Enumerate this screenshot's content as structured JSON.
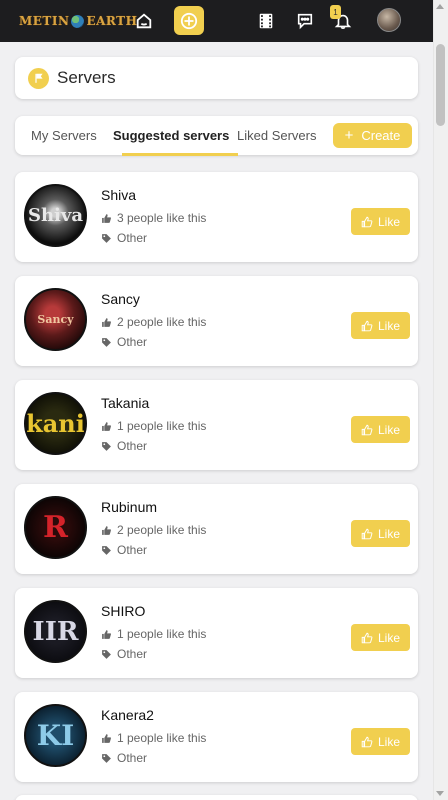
{
  "app": {
    "logo_left": "METIN",
    "logo_right": "EARTH",
    "notification_count": "1"
  },
  "header": {
    "title": "Servers"
  },
  "tabs": [
    {
      "label": "My Servers"
    },
    {
      "label": "Suggested servers",
      "active": true
    },
    {
      "label": "Liked Servers"
    }
  ],
  "create_button": {
    "plus": "+",
    "label": "Create"
  },
  "servers": [
    {
      "name": "Shiva",
      "likes": "3 people like this",
      "category": "Other",
      "like_label": "Like",
      "avatar_text": "Shiva"
    },
    {
      "name": "Sancy",
      "likes": "2 people like this",
      "category": "Other",
      "like_label": "Like",
      "avatar_text": "Sancy"
    },
    {
      "name": "Takania",
      "likes": "1 people like this",
      "category": "Other",
      "like_label": "Like",
      "avatar_text": "kani"
    },
    {
      "name": "Rubinum",
      "likes": "2 people like this",
      "category": "Other",
      "like_label": "Like",
      "avatar_text": "R"
    },
    {
      "name": "SHIRO",
      "likes": "1 people like this",
      "category": "Other",
      "like_label": "Like",
      "avatar_text": "IIR"
    },
    {
      "name": "Kanera2",
      "likes": "1 people like this",
      "category": "Other",
      "like_label": "Like",
      "avatar_text": "KI"
    }
  ],
  "colors": {
    "accent": "#f1cf4f",
    "topbar": "#1d1d1f",
    "background": "#f0f0f2"
  }
}
